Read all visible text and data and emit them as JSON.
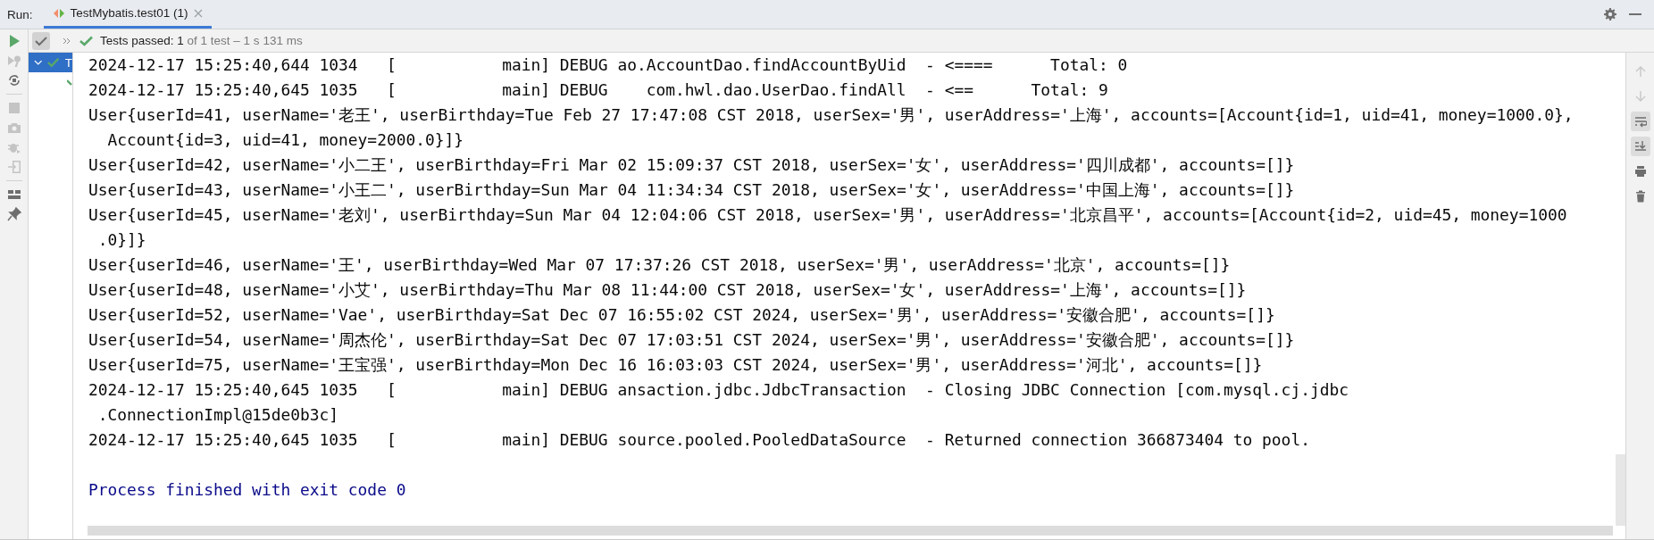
{
  "tool_window": {
    "title": "Run:",
    "tabs": [
      {
        "label": "TestMybatis.test01 (1)",
        "selected": true
      }
    ]
  },
  "side_actions": [
    {
      "kind": "run",
      "disabled": false
    },
    {
      "kind": "rerun-failed",
      "disabled": true
    },
    {
      "kind": "auto-test",
      "disabled": false
    },
    {
      "kind": "stop",
      "disabled": true
    },
    {
      "kind": "camera",
      "disabled": true
    },
    {
      "kind": "debug",
      "disabled": true
    },
    {
      "kind": "import",
      "disabled": true
    },
    {
      "kind": "layout",
      "disabled": false
    },
    {
      "kind": "pin",
      "disabled": false
    }
  ],
  "test_toolbar": {
    "show_passed": {
      "selected": true
    },
    "status": {
      "passed": true,
      "label": "Tests passed:",
      "count": "1",
      "detail": "of 1 test – 1 s 131 ms"
    }
  },
  "test_tree": [
    {
      "label": "T",
      "passed": true,
      "selected": true,
      "expanded": true,
      "children": [
        {
          "passed": true
        }
      ]
    }
  ],
  "console": {
    "lines": [
      {
        "kind": "log",
        "text": "2024-12-17 15:25:40,644 1034   [           main] DEBUG ao.AccountDao.findAccountByUid  - <====      Total: 0"
      },
      {
        "kind": "log",
        "text": "2024-12-17 15:25:40,645 1035   [           main] DEBUG    com.hwl.dao.UserDao.findAll  - <==      Total: 9"
      },
      {
        "kind": "log",
        "text": "User{userId=41, userName='老王', userBirthday=Tue Feb 27 17:47:08 CST 2018, userSex='男', userAddress='上海', accounts=[Account{id=1, uid=41, money=1000.0},"
      },
      {
        "kind": "wrap",
        "text": " Account{id=3, uid=41, money=2000.0}]}"
      },
      {
        "kind": "log",
        "text": "User{userId=42, userName='小二王', userBirthday=Fri Mar 02 15:09:37 CST 2018, userSex='女', userAddress='四川成都', accounts=[]}"
      },
      {
        "kind": "log",
        "text": "User{userId=43, userName='小王二', userBirthday=Sun Mar 04 11:34:34 CST 2018, userSex='女', userAddress='中国上海', accounts=[]}"
      },
      {
        "kind": "log",
        "text": "User{userId=45, userName='老刘', userBirthday=Sun Mar 04 12:04:06 CST 2018, userSex='男', userAddress='北京昌平', accounts=[Account{id=2, uid=45, money=1000"
      },
      {
        "kind": "wrap",
        "text": ".0}]}"
      },
      {
        "kind": "log",
        "text": "User{userId=46, userName='王', userBirthday=Wed Mar 07 17:37:26 CST 2018, userSex='男', userAddress='北京', accounts=[]}"
      },
      {
        "kind": "log",
        "text": "User{userId=48, userName='小艾', userBirthday=Thu Mar 08 11:44:00 CST 2018, userSex='女', userAddress='上海', accounts=[]}"
      },
      {
        "kind": "log",
        "text": "User{userId=52, userName='Vae', userBirthday=Sat Dec 07 16:55:02 CST 2024, userSex='男', userAddress='安徽合肥', accounts=[]}"
      },
      {
        "kind": "log",
        "text": "User{userId=54, userName='周杰伦', userBirthday=Sat Dec 07 17:03:51 CST 2024, userSex='男', userAddress='安徽合肥', accounts=[]}"
      },
      {
        "kind": "log",
        "text": "User{userId=75, userName='王宝强', userBirthday=Mon Dec 16 16:03:03 CST 2024, userSex='男', userAddress='河北', accounts=[]}"
      },
      {
        "kind": "log",
        "text": "2024-12-17 15:25:40,645 1035   [           main] DEBUG ansaction.jdbc.JdbcTransaction  - Closing JDBC Connection [com.mysql.cj.jdbc"
      },
      {
        "kind": "wrap",
        "text": ".ConnectionImpl@15de0b3c]"
      },
      {
        "kind": "log",
        "text": "2024-12-17 15:25:40,645 1035   [           main] DEBUG source.pooled.PooledDataSource  - Returned connection 366873404 to pool."
      },
      {
        "kind": "blank"
      },
      {
        "kind": "system",
        "text": "Process finished with exit code 0"
      }
    ]
  },
  "console_actions": [
    {
      "kind": "up",
      "disabled": true,
      "selected": false
    },
    {
      "kind": "down",
      "disabled": true,
      "selected": false
    },
    {
      "kind": "soft-wrap",
      "disabled": false,
      "selected": true
    },
    {
      "kind": "scroll-end",
      "disabled": false,
      "selected": true
    },
    {
      "kind": "print",
      "disabled": false,
      "selected": false
    },
    {
      "kind": "clear",
      "disabled": false,
      "selected": false
    }
  ]
}
